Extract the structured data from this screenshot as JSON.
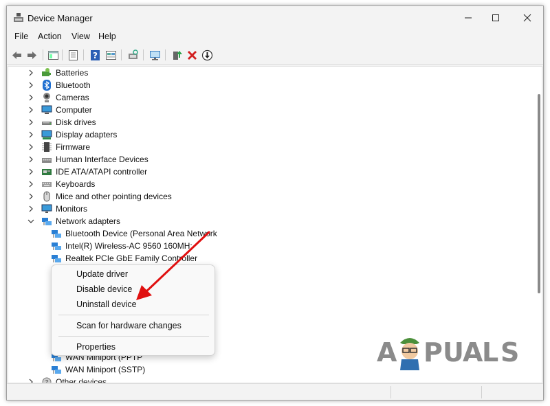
{
  "window": {
    "title": "Device Manager"
  },
  "menu": [
    "File",
    "Action",
    "View",
    "Help"
  ],
  "toolbar": {
    "buttons": [
      "back-icon",
      "forward-icon",
      "properties-pane-icon",
      "list-icon",
      "help-icon",
      "view-icon",
      "scan-hardware-icon",
      "monitor-icon",
      "update-driver-icon",
      "uninstall-icon",
      "download-icon"
    ]
  },
  "tree": {
    "categories": [
      {
        "label": "Batteries",
        "icon": "battery-icon"
      },
      {
        "label": "Bluetooth",
        "icon": "bluetooth-icon"
      },
      {
        "label": "Cameras",
        "icon": "camera-icon"
      },
      {
        "label": "Computer",
        "icon": "computer-icon"
      },
      {
        "label": "Disk drives",
        "icon": "disk-drive-icon"
      },
      {
        "label": "Display adapters",
        "icon": "display-adapter-icon"
      },
      {
        "label": "Firmware",
        "icon": "firmware-icon"
      },
      {
        "label": "Human Interface Devices",
        "icon": "hid-icon"
      },
      {
        "label": "IDE ATA/ATAPI controller",
        "icon": "ide-controller-icon"
      },
      {
        "label": "Keyboards",
        "icon": "keyboard-icon"
      },
      {
        "label": "Mice and other pointing devices",
        "icon": "mouse-icon"
      },
      {
        "label": "Monitors",
        "icon": "monitor-icon"
      }
    ],
    "expanded_category": {
      "label": "Network adapters",
      "icon": "network-adapter-icon"
    },
    "network_children": [
      "Bluetooth Device (Personal Area Network",
      "Intel(R) Wireless-AC 9560 160MH:",
      "Realtek PCIe GbE Family Controller"
    ],
    "network_children_after_menu": [
      "WAN Miniport (PPTP",
      "WAN Miniport (SSTP)"
    ],
    "last_category": {
      "label": "Other devices",
      "icon": "other-devices-icon"
    }
  },
  "context_menu": {
    "items": [
      "Update driver",
      "Disable device",
      "Uninstall device"
    ],
    "scan": "Scan for hardware changes",
    "properties": "Properties"
  },
  "watermark": {
    "letters": [
      "A",
      "P",
      "U",
      "A",
      "L",
      "S"
    ]
  },
  "colors": {
    "arrow": "#e01010",
    "network_icon": "#2a7fd4",
    "uninstall_red": "#d21f1f"
  }
}
